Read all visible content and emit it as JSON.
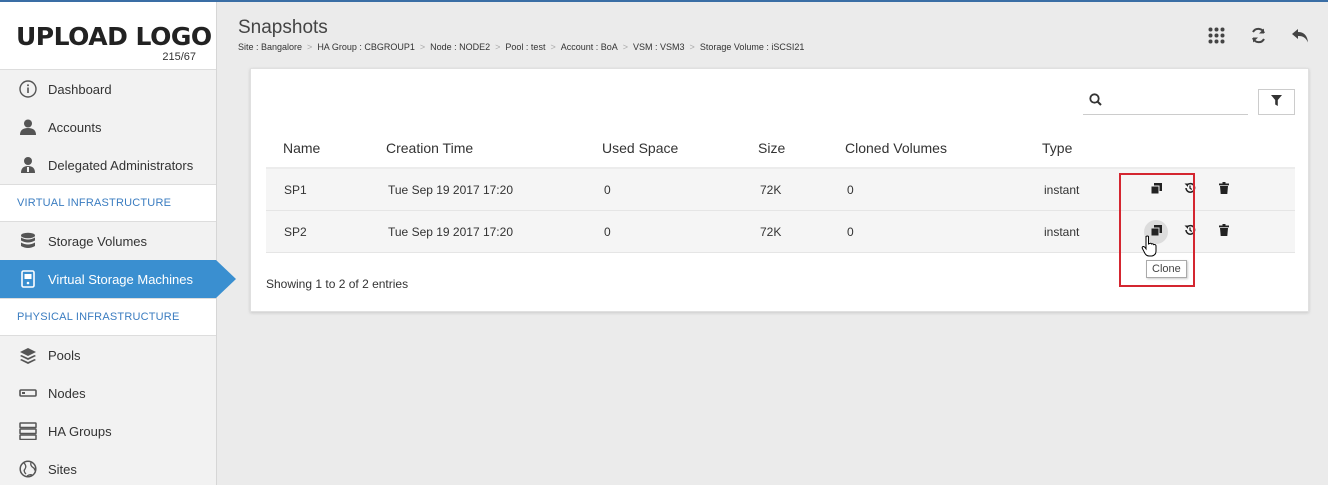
{
  "logo": {
    "text": "UPLOAD LOGO",
    "size": "215/67"
  },
  "sidebar": {
    "top_items": [
      {
        "label": "Dashboard",
        "icon": "info-icon"
      },
      {
        "label": "Accounts",
        "icon": "user-icon"
      },
      {
        "label": "Delegated Administrators",
        "icon": "admin-icon"
      }
    ],
    "virtual_section": "VIRTUAL INFRASTRUCTURE",
    "virtual_items": [
      {
        "label": "Storage Volumes",
        "icon": "database-icon"
      },
      {
        "label": "Virtual Storage Machines",
        "icon": "server-icon",
        "active": true
      }
    ],
    "physical_section": "PHYSICAL INFRASTRUCTURE",
    "physical_items": [
      {
        "label": "Pools",
        "icon": "layers-icon"
      },
      {
        "label": "Nodes",
        "icon": "node-icon"
      },
      {
        "label": "HA Groups",
        "icon": "stack-icon"
      },
      {
        "label": "Sites",
        "icon": "globe-icon"
      }
    ]
  },
  "header": {
    "title": "Snapshots",
    "breadcrumb": [
      "Site : Bangalore",
      "HA Group : CBGROUP1",
      "Node : NODE2",
      "Pool : test",
      "Account : BoA",
      "VSM : VSM3",
      "Storage Volume : iSCSI21"
    ],
    "actions": [
      "grid-icon",
      "refresh-icon",
      "back-icon"
    ]
  },
  "search": {
    "placeholder": ""
  },
  "table": {
    "columns": [
      "Name",
      "Creation Time",
      "Used Space",
      "Size",
      "Cloned Volumes",
      "Type"
    ],
    "rows": [
      {
        "name": "SP1",
        "creation_time": "Tue Sep 19 2017 17:20",
        "used_space": "0",
        "size": "72K",
        "cloned_volumes": "0",
        "type": "instant"
      },
      {
        "name": "SP2",
        "creation_time": "Tue Sep 19 2017 17:20",
        "used_space": "0",
        "size": "72K",
        "cloned_volumes": "0",
        "type": "instant"
      }
    ],
    "footer": "Showing 1 to 2 of 2 entries"
  },
  "tooltip": "Clone",
  "colors": {
    "accent": "#3a8fd0",
    "highlight": "#d42630",
    "section_label": "#3a7cc0"
  }
}
